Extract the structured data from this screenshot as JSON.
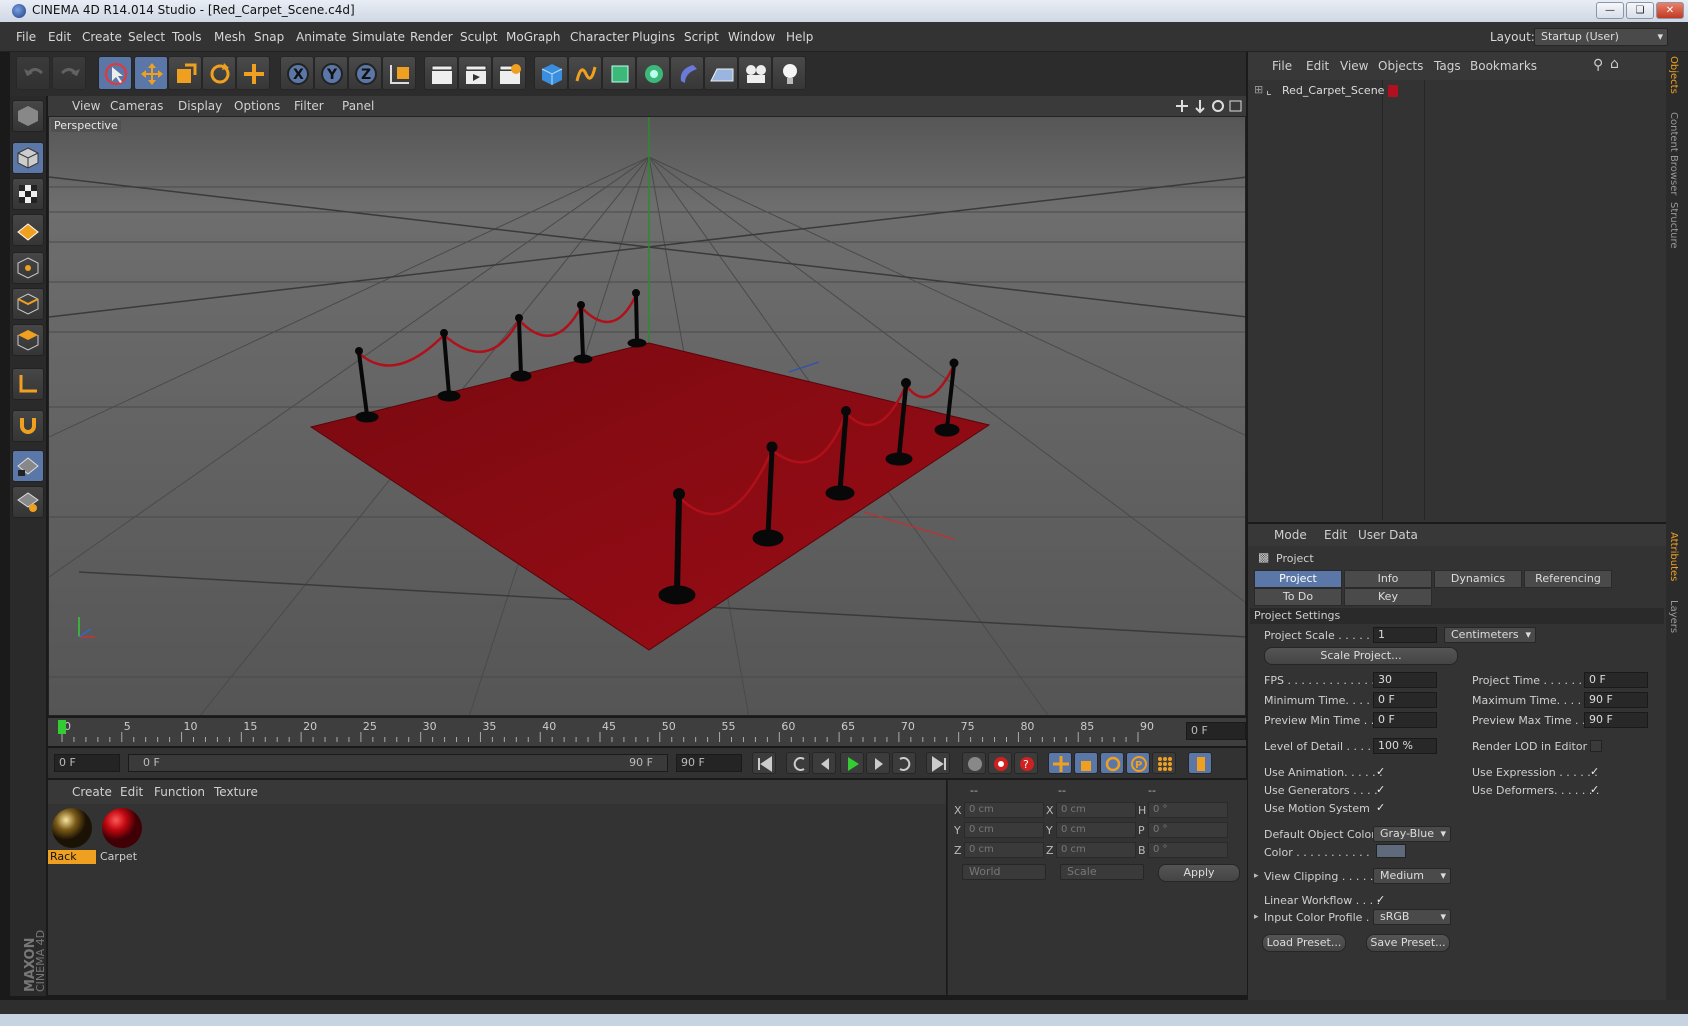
{
  "window": {
    "title": "CINEMA 4D R14.014 Studio - [Red_Carpet_Scene.c4d]"
  },
  "menu": [
    "File",
    "Edit",
    "Create",
    "Select",
    "Tools",
    "Mesh",
    "Snap",
    "Animate",
    "Simulate",
    "Render",
    "Sculpt",
    "MoGraph",
    "Character",
    "Plugins",
    "Script",
    "Window",
    "Help"
  ],
  "layout": {
    "label": "Layout:",
    "value": "Startup (User)"
  },
  "viewport": {
    "menu": [
      "View",
      "Cameras",
      "Display",
      "Options",
      "Filter",
      "Panel"
    ],
    "label": "Perspective"
  },
  "timeline": {
    "ticks": [
      "0",
      "5",
      "10",
      "15",
      "20",
      "25",
      "30",
      "35",
      "40",
      "45",
      "50",
      "55",
      "60",
      "65",
      "70",
      "75",
      "80",
      "85",
      "90"
    ],
    "frame": "0 F"
  },
  "anim": {
    "start": "0 F",
    "range_start": "0 F",
    "range_end": "90 F",
    "end": "90 F"
  },
  "materials": {
    "menu": [
      "Create",
      "Edit",
      "Function",
      "Texture"
    ],
    "items": [
      {
        "name": "Rack"
      },
      {
        "name": "Carpet"
      }
    ]
  },
  "coords": {
    "headers": [
      "--",
      "--",
      "--"
    ],
    "rows": [
      {
        "a": "X",
        "av": "0 cm",
        "b": "X",
        "bv": "0 cm",
        "c": "H",
        "cv": "0 °"
      },
      {
        "a": "Y",
        "av": "0 cm",
        "b": "Y",
        "bv": "0 cm",
        "c": "P",
        "cv": "0 °"
      },
      {
        "a": "Z",
        "av": "0 cm",
        "b": "Z",
        "bv": "0 cm",
        "c": "B",
        "cv": "0 °"
      }
    ],
    "world": "World",
    "scale": "Scale",
    "apply": "Apply"
  },
  "objects": {
    "menu": [
      "File",
      "Edit",
      "View",
      "Objects",
      "Tags",
      "Bookmarks"
    ],
    "item": "Red_Carpet_Scene"
  },
  "attributes": {
    "menu": [
      "Mode",
      "Edit",
      "User Data"
    ],
    "title": "Project",
    "tabs": [
      "Project Settings",
      "Info",
      "Dynamics",
      "Referencing"
    ],
    "tabs2": [
      "To Do",
      "Key Interpolation"
    ],
    "section": "Project Settings",
    "project_scale_label": "Project Scale . . . . . .",
    "project_scale": "1",
    "unit": "Centimeters",
    "scale_project": "Scale Project...",
    "fps_label": "FPS . . . . . . . . . . . . . .",
    "fps": "30",
    "project_time_label": "Project Time . . . . . . . .",
    "project_time": "0 F",
    "min_time_label": "Minimum Time. . . . . .",
    "min_time": "0 F",
    "max_time_label": "Maximum Time. . . . . . .",
    "max_time": "90 F",
    "prev_min_label": "Preview Min Time . . .",
    "prev_min": "0 F",
    "prev_max_label": "Preview Max Time . . . .",
    "prev_max": "90 F",
    "lod_label": "Level of Detail . . . . . .",
    "lod": "100 %",
    "render_lod_label": "Render LOD in Editor",
    "use_animation": "Use Animation. . . . . .",
    "use_expression": "Use Expression . . . . . .",
    "use_generators": "Use Generators . . . .",
    "use_deformers": "Use Deformers. . . . . . .",
    "use_motion": "Use Motion System",
    "def_color_label": "Default Object Color",
    "def_color": "Gray-Blue",
    "color_label": "Color . . . . . . . . . . .",
    "view_clip_label": "View Clipping . . . . .",
    "view_clip": "Medium",
    "linear_label": "Linear Workflow . . . .",
    "input_profile_label": "Input Color Profile .",
    "input_profile": "sRGB",
    "load_preset": "Load Preset...",
    "save_preset": "Save Preset..."
  },
  "side_tabs": [
    "Objects",
    "Content Browser",
    "Structure",
    "Attributes",
    "Layers"
  ],
  "brand": "MAXON CINEMA 4D",
  "colors": {
    "carpet": "#8a0a12",
    "accent": "#5a77a8",
    "rope": "#b0101a"
  }
}
